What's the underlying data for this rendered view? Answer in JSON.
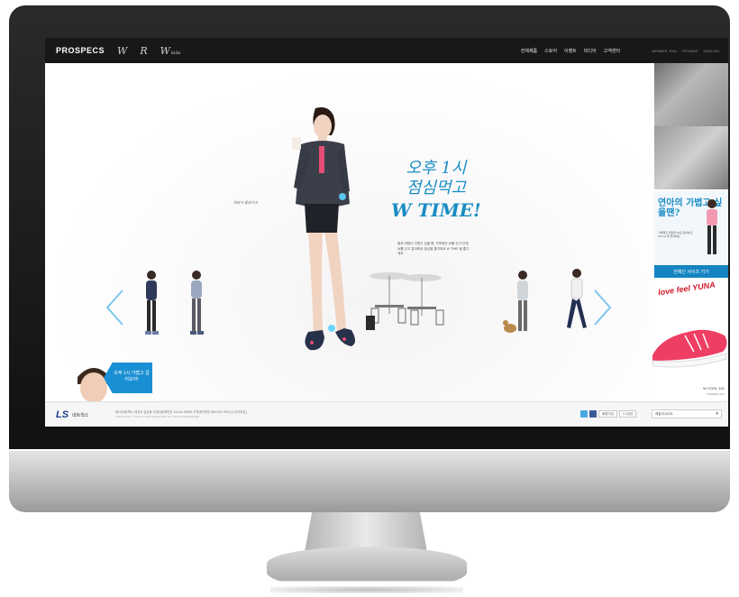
{
  "header": {
    "logo": "PROSPECS",
    "sub_brands": [
      "W",
      "R",
      "W"
    ],
    "sub_brand_suffix": "kids",
    "nav": [
      "전체제품",
      "스토어",
      "이벤트",
      "미디어",
      "고객센터"
    ],
    "util": [
      "MEMBER JOIN",
      "SITEMAP",
      "ENGLISH"
    ]
  },
  "hero": {
    "headline_line1": "오후 1시",
    "headline_line2": "점심먹고",
    "headline_line3": "W TIME!",
    "scribble": "따라가 올라가시",
    "body": "몸과 마음이 가볍고 싶을 땐, 가벼워진 W를 신고 단체 W를 신고 걸어봐요 점심을 즐거워요 W TIME 을 즐기세요",
    "callout": "오후 1시 가볍고 걸어보자!"
  },
  "sidebar": {
    "promo_title": "연아의 가볍고 싶을땐?",
    "promo_sub": "가벼워진 워킹화 W로 걸어봐요 W time 을 즐겨봐요",
    "promo_button": "전체인 사이즈 가기",
    "shoe_ad": "love feel YUNA",
    "shoe_name": "W COOL 101",
    "shoe_code": "PWM0902-031"
  },
  "footer": {
    "brand": "LS",
    "brand_sub": "네트웍스",
    "info": "㈜LS네트웍스  대표자 김승동  사업자등록번호 116-81-03095  고객센터번호 080-513-7533 (수신자부담)",
    "copy": "COPYRIGHT © 2011 LS NETWORKS INC. ALL RIGHTS RESERVED.",
    "buttons": [
      "회원가입",
      "1:1상담"
    ],
    "family_site": "패밀리사이트"
  },
  "colors": {
    "accent": "#1a8cc4",
    "topbar": "#181818",
    "shoe": "#ef3e63",
    "ad_red": "#d01a2a"
  }
}
